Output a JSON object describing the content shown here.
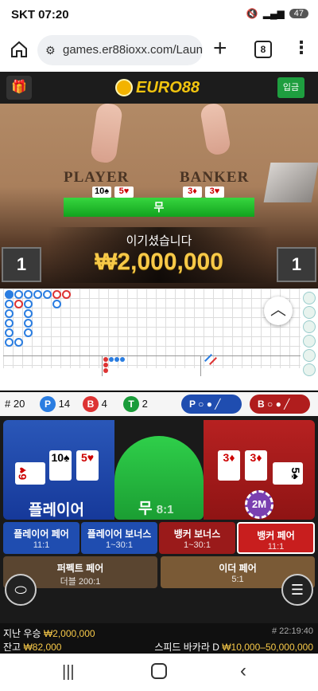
{
  "status": {
    "carrier": "SKT",
    "time": "07:20",
    "battery": "47"
  },
  "browser": {
    "url": "games.er88ioxx.com/Launc",
    "tab_count": "8"
  },
  "header": {
    "logo_text": "EURO88",
    "deposit_label": "입금"
  },
  "video": {
    "player_label": "PLAYER",
    "banker_label": "BANKER",
    "result_label": "무",
    "win_message": "이기셨습니다",
    "win_amount": "₩2,000,000",
    "left_count": "1",
    "right_count": "1",
    "player_cards": [
      "10♠",
      "5♥"
    ],
    "banker_cards": [
      "3♦",
      "3♥"
    ]
  },
  "stats": {
    "rounds_label": "# 20",
    "player_letter": "P",
    "player_count": "14",
    "banker_letter": "B",
    "banker_count": "4",
    "tie_letter": "T",
    "tie_count": "2",
    "player_pill": "P",
    "banker_pill": "B"
  },
  "betting": {
    "player_label": "플레이어",
    "tie_label": "무",
    "tie_odds": "8:1",
    "chip_label": "2M",
    "player_cards": [
      "6♥",
      "10♠",
      "5♥"
    ],
    "banker_cards": [
      "3♦",
      "3♦",
      "5♠"
    ],
    "side_bets": [
      {
        "label": "플레이어 페어",
        "odds": "11:1"
      },
      {
        "label": "플레이어 보너스",
        "odds": "1~30:1"
      },
      {
        "label": "뱅커 보너스",
        "odds": "1~30:1"
      },
      {
        "label": "뱅커 페어",
        "odds": "11:1"
      }
    ],
    "perfect_pair": {
      "label": "퍼펙트 페어",
      "odds": "더블 200:1"
    },
    "either_pair": {
      "label": "이더 페어",
      "odds": "5:1"
    }
  },
  "footer": {
    "last_win_label": "지난 우승",
    "last_win_value": "₩2,000,000",
    "balance_label": "잔고",
    "balance_value": "₩82,000",
    "round_id": "# 22:19:40",
    "table_name": "스피드 바카라 D",
    "limits": "₩10,000–50,000,000"
  },
  "colors": {
    "player": "#1f4db0",
    "banker": "#b01d1d",
    "tie": "#22b33a",
    "gold": "#f7c948"
  }
}
